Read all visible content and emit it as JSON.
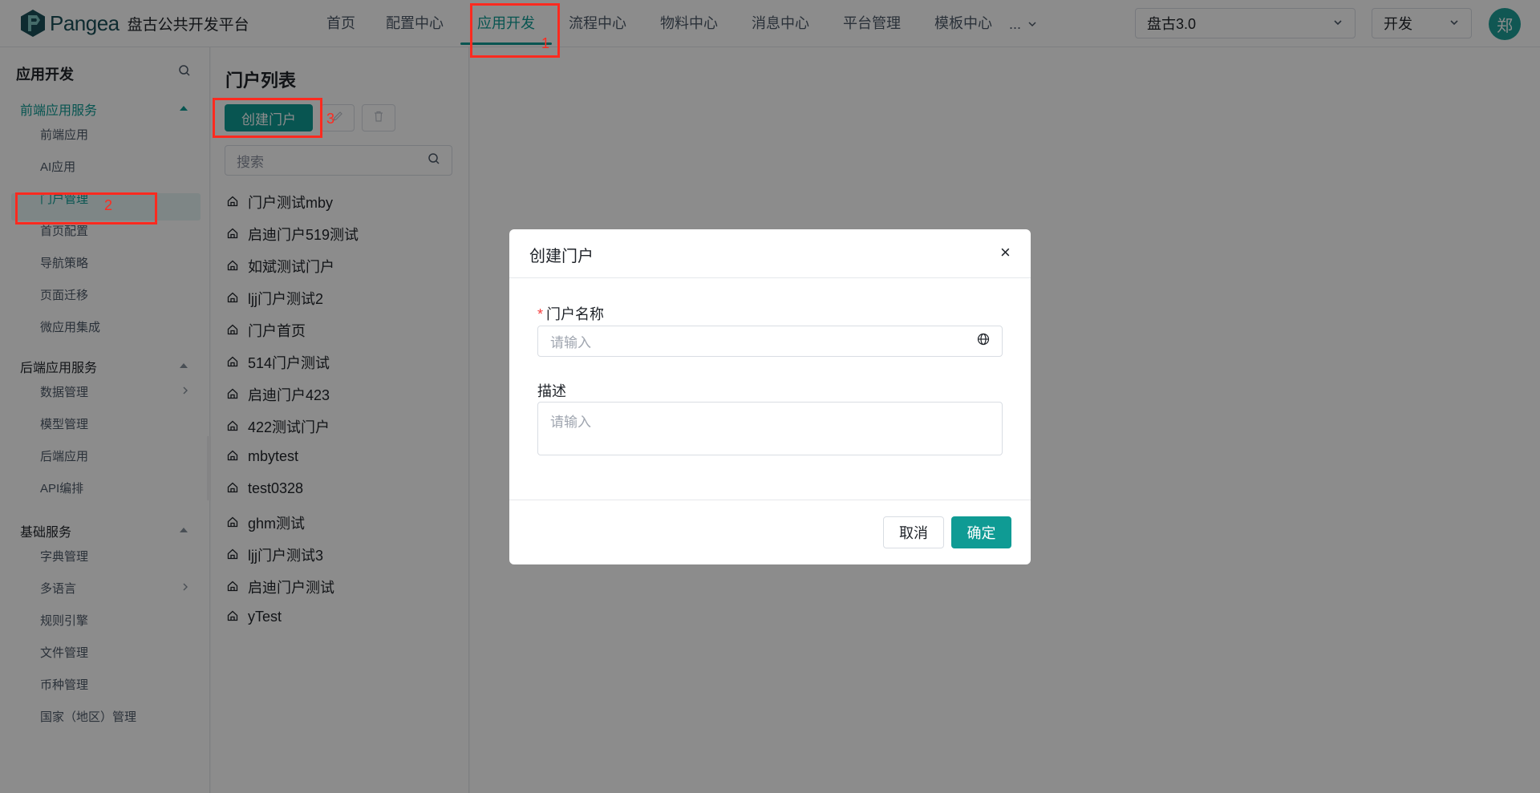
{
  "header": {
    "brand_word": "Pangea",
    "brand_sub": "盘古公共开发平台",
    "nav": [
      "首页",
      "配置中心",
      "应用开发",
      "流程中心",
      "物料中心",
      "消息中心",
      "平台管理",
      "模板中心"
    ],
    "nav_active_index": 2,
    "nav_more": "...",
    "tenant_select": "盘古3.0",
    "env_select": "开发",
    "avatar_text": "郑"
  },
  "sidebar": {
    "title": "应用开发",
    "groups": [
      {
        "label": "前端应用服务",
        "items": [
          "前端应用",
          "AI应用",
          "门户管理",
          "首页配置",
          "导航策略",
          "页面迁移",
          "微应用集成"
        ]
      },
      {
        "label": "后端应用服务",
        "items": [
          "数据管理",
          "模型管理",
          "后端应用",
          "API编排"
        ]
      },
      {
        "label": "基础服务",
        "items": [
          "字典管理",
          "多语言",
          "规则引擎",
          "文件管理",
          "币种管理",
          "国家（地区）管理"
        ]
      }
    ],
    "selected_item": "门户管理"
  },
  "portal_panel": {
    "title": "门户列表",
    "create_button": "创建门户",
    "search_placeholder": "搜索",
    "items": [
      "门户测试mby",
      "启迪门户519测试",
      "如斌测试门户",
      "ljj门户测试2",
      "门户首页",
      "514门户测试",
      "启迪门户423",
      "422测试门户",
      "mbytest",
      "test0328",
      "ghm测试",
      "ljj门户测试3",
      "启迪门户测试",
      "yTest"
    ]
  },
  "modal": {
    "title": "创建门户",
    "close": "×",
    "name_label": "门户名称",
    "required_mark": "*",
    "name_placeholder": "请输入",
    "desc_label": "描述",
    "desc_placeholder": "请输入",
    "cancel": "取消",
    "ok": "确定"
  },
  "annotations": [
    "1",
    "2",
    "3"
  ],
  "colors": {
    "accent": "#0f9b94",
    "annotation": "#ff2a1f"
  }
}
